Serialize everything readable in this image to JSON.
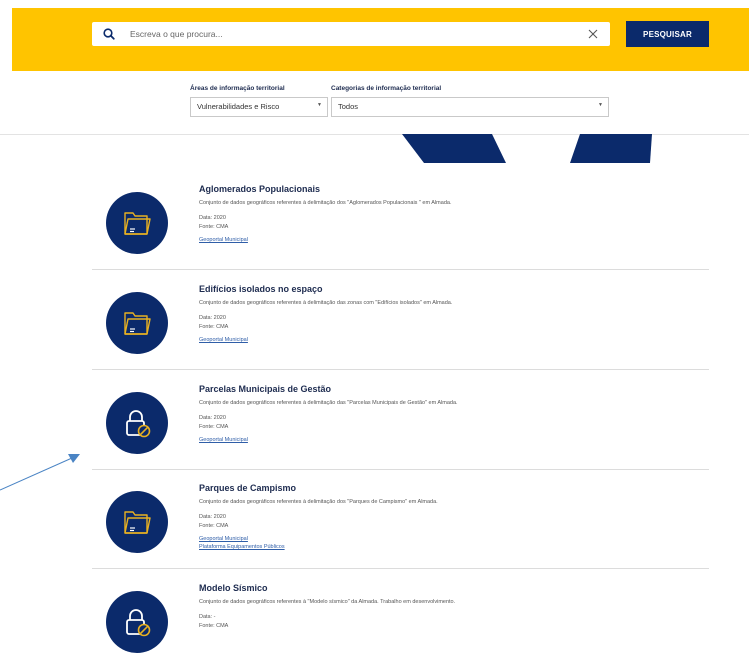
{
  "search": {
    "placeholder": "Escreva o que procura...",
    "button_label": "PESQUISAR"
  },
  "filters": {
    "areas": {
      "label": "Áreas de informação territorial",
      "value": "Vulnerabilidades e Risco"
    },
    "categorias": {
      "label": "Categorias de informação territorial",
      "value": "Todos"
    }
  },
  "colors": {
    "banner": "#ffc400",
    "navy": "#0b2a6b",
    "link": "#2f5ea8",
    "icon_gold": "#e8b122",
    "arrow": "#4a84c4"
  },
  "items": [
    {
      "icon": "folder-icon",
      "title": "Aglomerados Populacionais",
      "description": "Conjunto de dados geográficos referentes à delimitação dos \"Aglomerados Populacionais \" em Almada.",
      "date": "Data: 2020",
      "source": "Fonte: CMA",
      "links": [
        "Geoportal Municipal"
      ]
    },
    {
      "icon": "folder-icon",
      "title": "Edifícios isolados no espaço",
      "description": "Conjunto de dados geográficos referentes à delimitação das zonas com \"Edifícios isolados\" em Almada.",
      "date": "Data: 2020",
      "source": "Fonte: CMA",
      "links": [
        "Geoportal Municipal"
      ]
    },
    {
      "icon": "lock-icon",
      "title": "Parcelas Municipais de Gestão",
      "description": "Conjunto de dados geográficos referentes à delimitação das \"Parcelas Municipais de Gestão\" em Almada.",
      "date": "Data: 2020",
      "source": "Fonte: CMA",
      "links": [
        "Geoportal Municipal"
      ]
    },
    {
      "icon": "folder-icon",
      "title": "Parques de Campismo",
      "description": "Conjunto de dados geográficos referentes à delimitação dos \"Parques de Campismo\" em Almada.",
      "date": "Data: 2020",
      "source": "Fonte: CMA",
      "links": [
        "Geoportal Municipal",
        "Plataforma Equipamentos Públicos"
      ]
    },
    {
      "icon": "lock-icon",
      "title": "Modelo Sísmico",
      "description": "Conjunto de dados geográficos referentes à \"Modelo sísmico\" da Almada. Trabalho em desenvolvimento.",
      "date": "Data: -",
      "source": "Fonte: CMA",
      "links": []
    }
  ]
}
